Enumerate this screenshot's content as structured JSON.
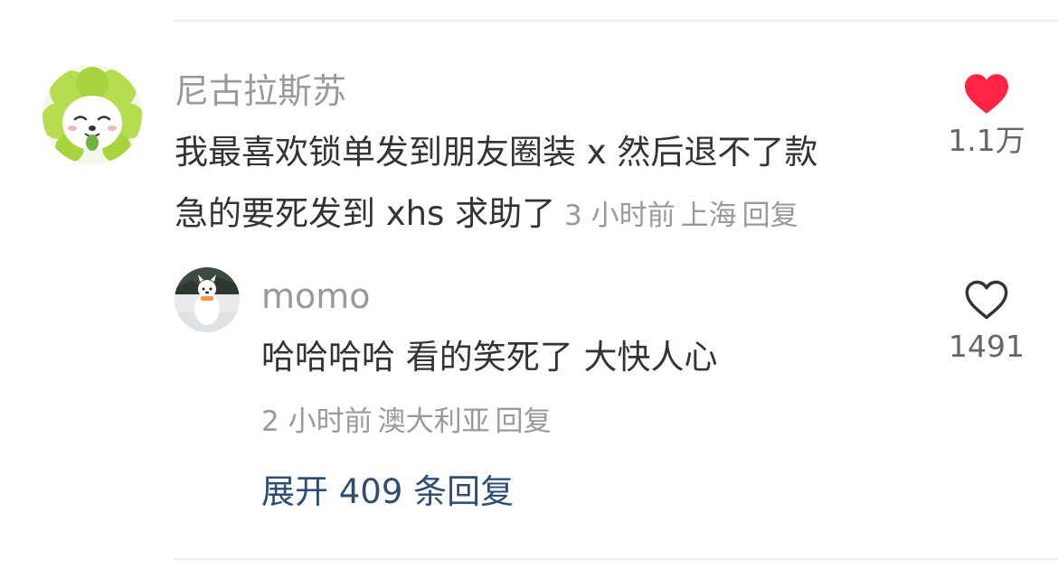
{
  "comment": {
    "author": "尼古拉斯苏",
    "text_line1": "我最喜欢锁单发到朋友圈装 x 然后退不了款",
    "text_line2": "急的要死发到 xhs 求助了",
    "time": "3 小时前",
    "location": "上海",
    "reply_label": "回复",
    "likes": "1.1万",
    "liked": true,
    "heart_color": "#ff2442"
  },
  "reply": {
    "author": "momo",
    "text": "哈哈哈哈 看的笑死了 大快人心",
    "time": "2 小时前",
    "location": "澳大利亚",
    "reply_label": "回复",
    "likes": "1491",
    "liked": false
  },
  "expand_label": "展开 409 条回复",
  "colors": {
    "link": "#2d4e72",
    "muted": "#999999",
    "body_text": "#333333"
  }
}
